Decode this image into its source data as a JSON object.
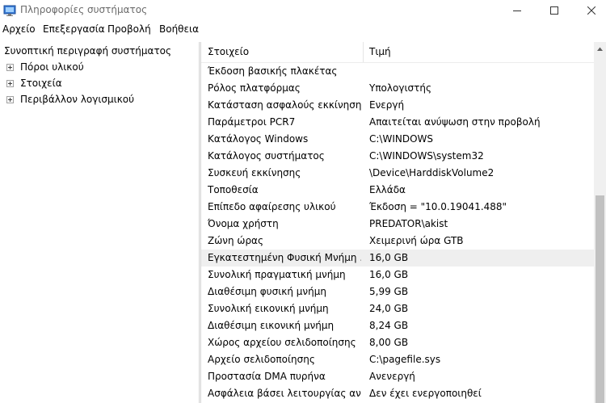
{
  "window": {
    "title": "Πληροφορίες συστήματος"
  },
  "menu": {
    "items": [
      "Αρχείο",
      "Επεξεργασία",
      "Προβολή",
      "Βοήθεια"
    ]
  },
  "tree": {
    "root": "Συνοπτική περιγραφή συστήματος",
    "children": [
      "Πόροι υλικού",
      "Στοιχεία",
      "Περιβάλλον λογισμικού"
    ]
  },
  "table": {
    "columns": [
      "Στοιχείο",
      "Τιμή"
    ],
    "rows": [
      {
        "item": "Έκδοση βασικής πλακέτας",
        "value": ""
      },
      {
        "item": "Ρόλος πλατφόρμας",
        "value": "Υπολογιστής"
      },
      {
        "item": "Κατάσταση ασφαλούς εκκίνησης",
        "value": "Ενεργή"
      },
      {
        "item": "Παράμετροι PCR7",
        "value": "Απαιτείται ανύψωση στην προβολή"
      },
      {
        "item": "Κατάλογος Windows",
        "value": "C:\\WINDOWS"
      },
      {
        "item": "Κατάλογος συστήματος",
        "value": "C:\\WINDOWS\\system32"
      },
      {
        "item": "Συσκευή εκκίνησης",
        "value": "\\Device\\HarddiskVolume2"
      },
      {
        "item": "Τοποθεσία",
        "value": "Ελλάδα"
      },
      {
        "item": "Επίπεδο αφαίρεσης υλικού",
        "value": "Έκδοση = \"10.0.19041.488\""
      },
      {
        "item": "Όνομα χρήστη",
        "value": "PREDATOR\\akist"
      },
      {
        "item": "Ζώνη ώρας",
        "value": "Χειμερινή ώρα GTB"
      },
      {
        "item": "Εγκατεστημένη Φυσική Μνήμη ...",
        "value": "16,0 GB"
      },
      {
        "item": "Συνολική πραγματική μνήμη",
        "value": "16,0 GB"
      },
      {
        "item": "Διαθέσιμη φυσική μνήμη",
        "value": "5,99 GB"
      },
      {
        "item": "Συνολική εικονική μνήμη",
        "value": "24,0 GB"
      },
      {
        "item": "Διαθέσιμη εικονική μνήμη",
        "value": "8,24 GB"
      },
      {
        "item": "Χώρος αρχείου σελιδοποίησης",
        "value": "8,00 GB"
      },
      {
        "item": "Αρχείο σελιδοποίησης",
        "value": "C:\\pagefile.sys"
      },
      {
        "item": "Προστασία DMA πυρήνα",
        "value": "Ανενεργή"
      },
      {
        "item": "Ασφάλεια βάσει λειτουργίας αν...",
        "value": "Δεν έχει ενεργοποιηθεί"
      }
    ]
  }
}
